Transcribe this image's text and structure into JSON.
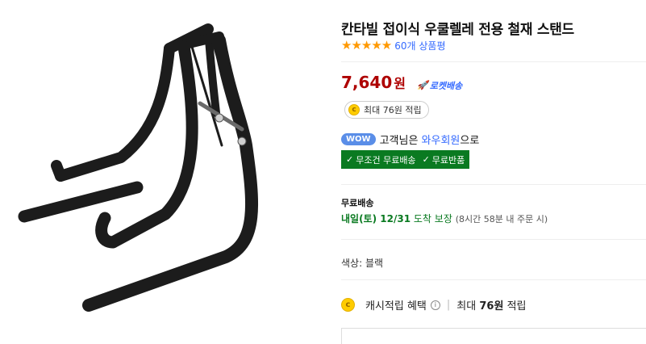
{
  "product": {
    "title": "칸타빌 접이식 우쿨렐레 전용 철재 스탠드",
    "stars": "★★★★★",
    "review_count": "60개 상품평",
    "price": "7,640",
    "currency": "원",
    "rocket_label": "로켓배송",
    "reward": "최대 76원 적립",
    "coin_letter": "c"
  },
  "wow": {
    "badge": "WOW",
    "text_prefix": "고객님은",
    "member_link": "와우회원",
    "text_suffix": "으로"
  },
  "benefits": {
    "free_shipping": "무조건 무료배송",
    "free_return": "무료반품"
  },
  "delivery": {
    "label": "무료배송",
    "date": "내일(토) 12/31",
    "guarantee": "도착 보장",
    "note": "(8시간 58분 내 주문 시)"
  },
  "option": {
    "color": "색상: 블랙"
  },
  "cash": {
    "label": "캐시적립 혜택",
    "info": "i",
    "separator": "|",
    "prefix": "최대",
    "amount": "76원",
    "suffix": "적립"
  },
  "colors": {
    "price": "#ae0000",
    "link": "#346aff",
    "green": "#0a7a21",
    "star": "#ff9900"
  }
}
